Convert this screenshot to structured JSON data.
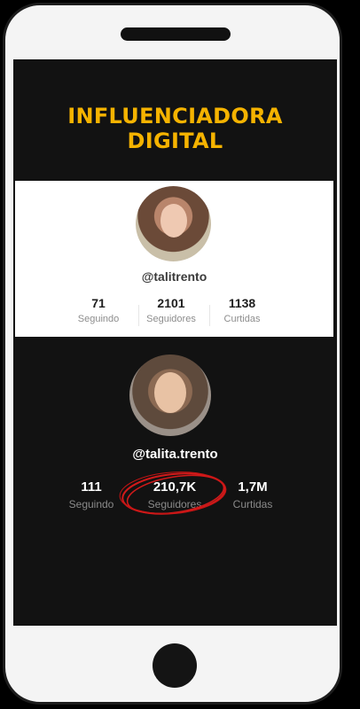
{
  "headline": {
    "line1": "INFLUENCIADORA",
    "line2": "DIGITAL"
  },
  "old_profile": {
    "handle": "@talitrento",
    "stats": [
      {
        "value": "71",
        "label": "Seguindo"
      },
      {
        "value": "2101",
        "label": "Seguidores"
      },
      {
        "value": "1138",
        "label": "Curtidas"
      }
    ]
  },
  "new_profile": {
    "handle": "@talita.trento",
    "stats": [
      {
        "value": "111",
        "label": "Seguindo"
      },
      {
        "value": "210,7K",
        "label": "Seguidores"
      },
      {
        "value": "1,7M",
        "label": "Curtidas"
      }
    ]
  },
  "colors": {
    "headline": "#f5b300",
    "highlight_circle": "#d11a1a",
    "screen_bg": "#121212"
  }
}
